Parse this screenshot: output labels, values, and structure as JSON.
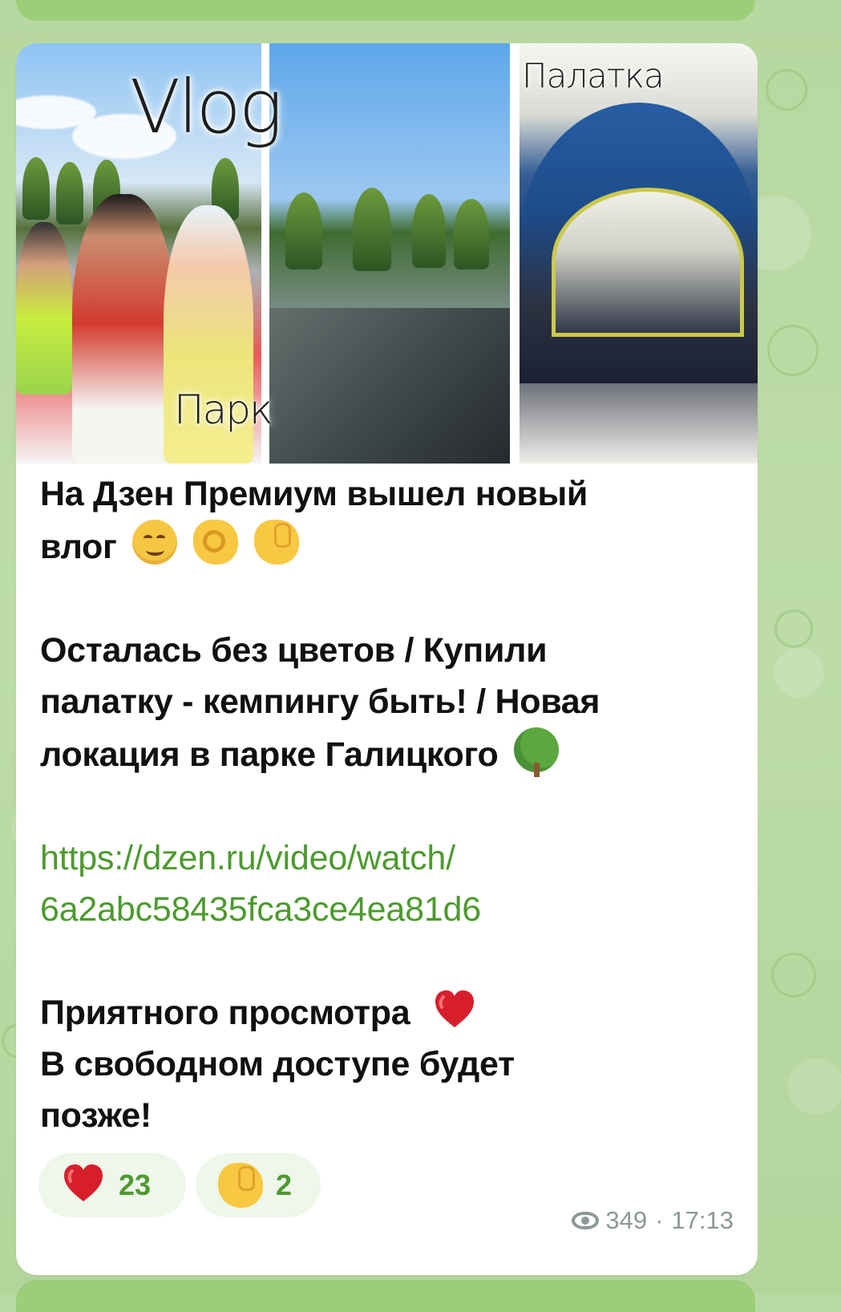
{
  "message": {
    "media": {
      "labels": {
        "vlog": "Vlog",
        "park": "Парк",
        "tent": "Палатка"
      }
    },
    "text": {
      "line1": "На Дзен Премиум вышел новый",
      "line2": "влог",
      "line3": "Осталась без цветов / Купили",
      "line4": "палатку - кемпингу быть! / Новая",
      "line5": "локация в парке Галицкого",
      "link_part1": "https://dzen.ru/video/watch/",
      "link_part2": "6a2abc58435fca3ce4ea81d6",
      "closing1": "Приятного просмотра",
      "closing2": "В свободном доступе будет",
      "closing3": "позже!"
    },
    "reactions": [
      {
        "icon": "red-heart-icon",
        "count": "23"
      },
      {
        "icon": "thumbs-up-icon",
        "count": "2"
      }
    ],
    "meta": {
      "views": "349",
      "separator": "·",
      "time": "17:13"
    },
    "colors": {
      "background": "#b9d9a3",
      "bubble": "#ffffff",
      "link": "#4d9a2f",
      "reaction_bg": "#eef7ea",
      "meta": "#8c9899"
    }
  }
}
